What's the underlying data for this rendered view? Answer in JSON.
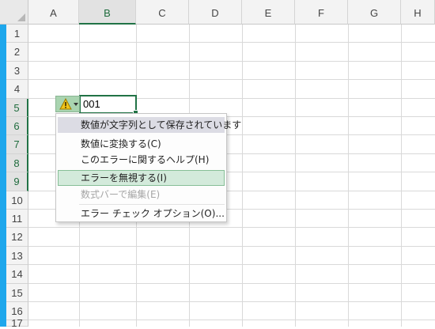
{
  "sheet": {
    "columns": [
      "A",
      "B",
      "C",
      "D",
      "E",
      "F",
      "G",
      "H"
    ],
    "selected_column": "B",
    "rows": [
      "1",
      "2",
      "3",
      "4",
      "5",
      "6",
      "7",
      "8",
      "9",
      "10",
      "11",
      "12",
      "13",
      "14",
      "15",
      "16",
      "17"
    ],
    "selected_rows": [
      "5",
      "6",
      "7",
      "8",
      "9"
    ],
    "active_cell_value": "001"
  },
  "error_menu": {
    "header": "数値が文字列として保存されています",
    "items": [
      {
        "label": "数値に変換する(C)",
        "enabled": true
      },
      {
        "label": "このエラーに関するヘルプ(H)",
        "enabled": true
      },
      {
        "label": "エラーを無視する(I)",
        "enabled": true,
        "highlighted": true
      },
      {
        "label": "数式バーで編集(E)",
        "enabled": false
      },
      {
        "label": "エラー チェック オプション(O)...",
        "enabled": true
      }
    ]
  },
  "icons": {
    "error_button": "warning-icon",
    "dropdown": "dropdown-arrow-icon"
  },
  "colors": {
    "accent_green": "#217346",
    "blue_bar": "#1ea7ec",
    "warning_yellow": "#f0c419"
  }
}
